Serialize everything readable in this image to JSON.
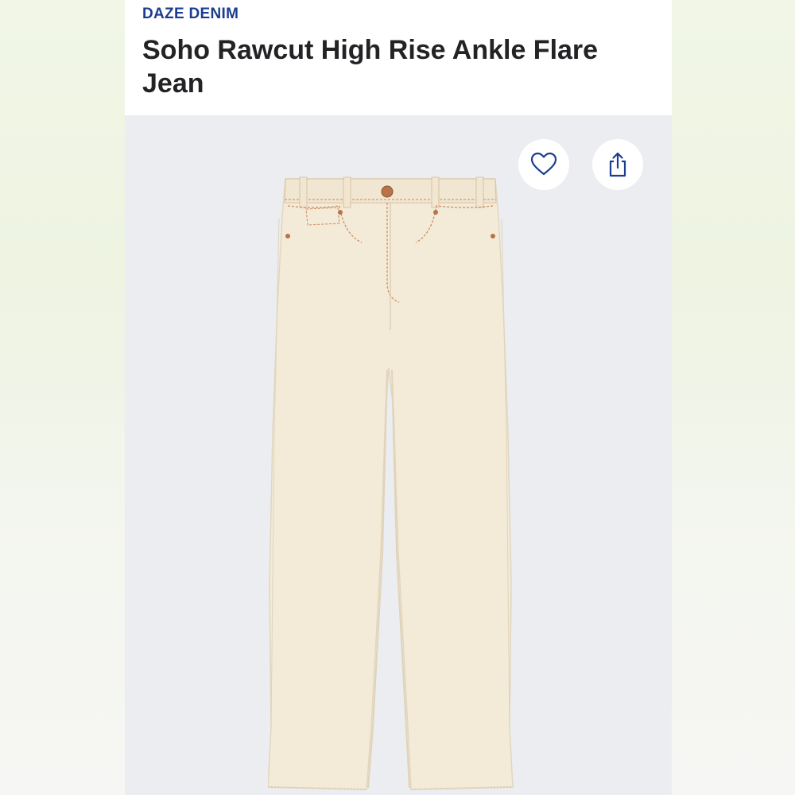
{
  "product": {
    "brand": "DAZE DENIM",
    "title": "Soho Rawcut High Rise Ankle Flare Jean"
  },
  "actions": {
    "favorite_icon": "heart-icon",
    "share_icon": "share-icon"
  },
  "colors": {
    "brand": "#1b3d8f",
    "title": "#232326",
    "image_background": "#ebedf0",
    "denim": "#f3ead8",
    "stitching": "#c98a5c",
    "rivets": "#b8734a"
  }
}
